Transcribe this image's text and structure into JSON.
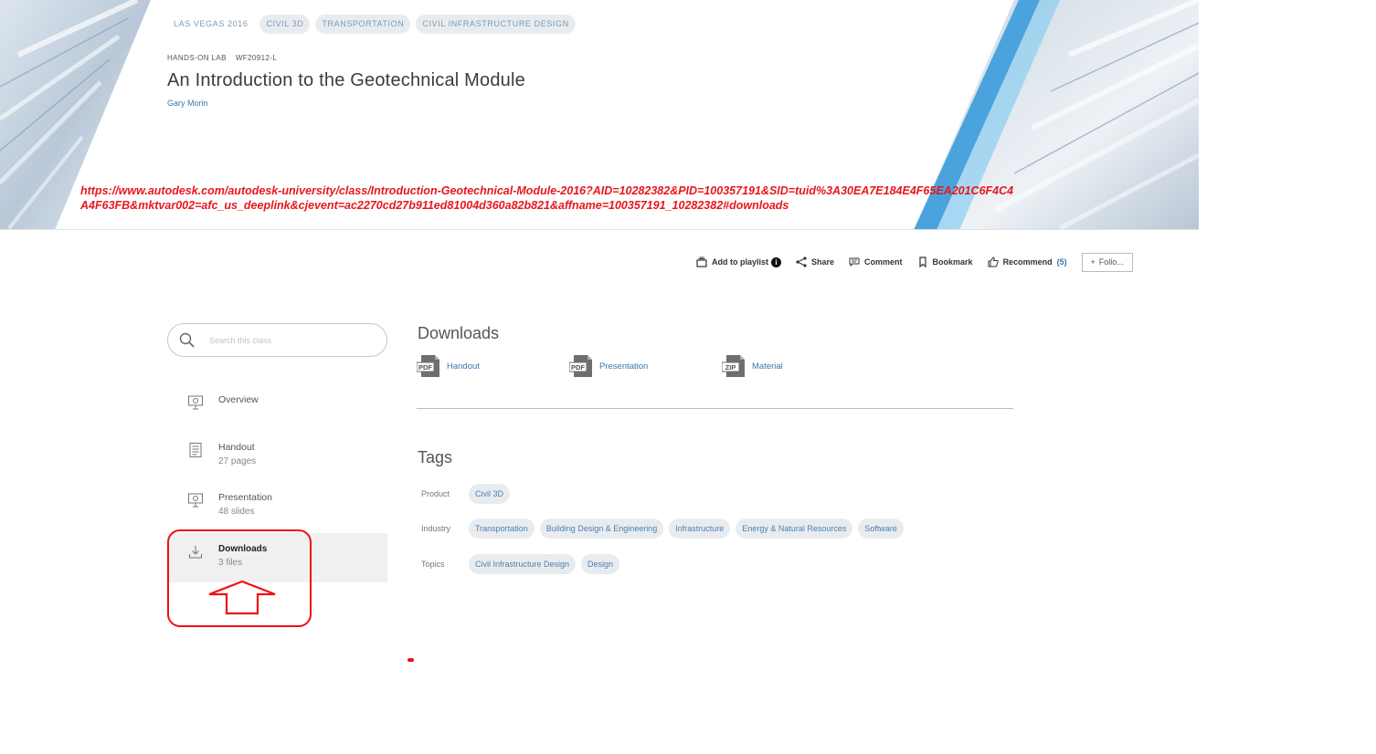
{
  "hero": {
    "chips": [
      "LAS VEGAS 2016",
      "CIVIL 3D",
      "TRANSPORTATION",
      "CIVIL INFRASTRUCTURE DESIGN"
    ],
    "session_type": "HANDS-ON LAB",
    "session_code": "WF20912-L",
    "title": "An Introduction to the Geotechnical Module",
    "author": "Gary Morin",
    "annotation_url": "https://www.autodesk.com/autodesk-university/class/Introduction-Geotechnical-Module-2016?AID=10282382&PID=100357191&SID=tuid%3A30EA7E184E4F65EA201C6F4C4A4F63FB&mktvar002=afc_us_deeplink&cjevent=ac2270cd27b911ed81004d360a82b821&affname=100357191_10282382#downloads"
  },
  "actions": {
    "playlist": "Add to playlist",
    "playlist_info": "i",
    "share": "Share",
    "comment": "Comment",
    "bookmark": "Bookmark",
    "recommend": "Recommend",
    "recommend_count": "(5)",
    "follow": "Follo..."
  },
  "sidebar": {
    "search_placeholder": "Search this class",
    "items": [
      {
        "label": "Overview",
        "sub": ""
      },
      {
        "label": "Handout",
        "sub": "27 pages"
      },
      {
        "label": "Presentation",
        "sub": "48 slides"
      },
      {
        "label": "Downloads",
        "sub": "3 files"
      }
    ]
  },
  "downloads": {
    "title": "Downloads",
    "items": [
      {
        "type": "PDF",
        "label": "Handout"
      },
      {
        "type": "PDF",
        "label": "Presentation"
      },
      {
        "type": "ZIP",
        "label": "Material"
      }
    ]
  },
  "tags": {
    "title": "Tags",
    "rows": [
      {
        "label": "Product",
        "values": [
          "Civil 3D"
        ]
      },
      {
        "label": "Industry",
        "values": [
          "Transportation",
          "Building Design & Engineering",
          "Infrastructure",
          "Energy & Natural Resources",
          "Software"
        ]
      },
      {
        "label": "Topics",
        "values": [
          "Civil Infrastructure Design",
          "Design"
        ]
      }
    ]
  },
  "colors": {
    "accent_link": "#3c76a8",
    "annotation_red": "#e8161c",
    "tag_bg": "#e9ecef",
    "hero_blue": "#4aa3dc"
  }
}
